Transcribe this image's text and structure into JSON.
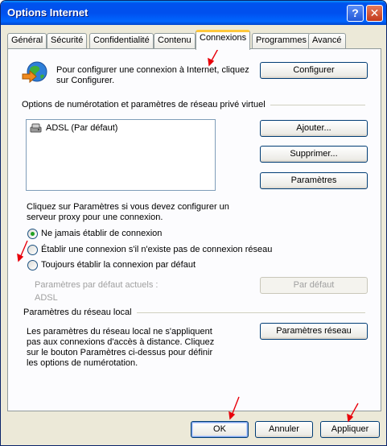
{
  "window": {
    "title": "Options Internet"
  },
  "tabs": [
    {
      "label": "Général"
    },
    {
      "label": "Sécurité"
    },
    {
      "label": "Confidentialité"
    },
    {
      "label": "Contenu"
    },
    {
      "label": "Connexions"
    },
    {
      "label": "Programmes"
    },
    {
      "label": "Avancé"
    }
  ],
  "setup": {
    "text_line1": "Pour configurer une connexion à Internet, cliquez",
    "text_line2": "sur Configurer.",
    "button": "Configurer"
  },
  "dialup": {
    "heading": "Options de numérotation et paramètres de réseau privé virtuel",
    "items": [
      "ADSL (Par défaut)"
    ],
    "add_button": "Ajouter...",
    "remove_button": "Supprimer...",
    "settings_button": "Paramètres",
    "proxy_text_line1": "Cliquez sur Paramètres si vous devez configurer un",
    "proxy_text_line2": "serveur proxy pour une connexion.",
    "options": [
      "Ne jamais établir de connexion",
      "Établir une connexion s'il n'existe pas de connexion réseau",
      "Toujours établir la connexion par défaut"
    ],
    "selected_option": "Ne jamais établir de connexion",
    "current_default_label": "Paramètres par défaut actuels :",
    "current_default_value": "ADSL",
    "default_button": "Par défaut"
  },
  "lan": {
    "heading": "Paramètres du réseau local",
    "text_lines": [
      "Les paramètres du réseau local ne s'appliquent",
      "pas aux connexions d'accès à distance. Cliquez",
      "sur le bouton Paramètres ci-dessus pour définir",
      "les options de numérotation."
    ],
    "button": "Paramètres réseau"
  },
  "footer": {
    "ok": "OK",
    "cancel": "Annuler",
    "apply": "Appliquer"
  },
  "colors": {
    "title_bar": "#0054e3",
    "dialog_bg": "#ece9d8",
    "annotation_arrow": "#e8000b"
  },
  "icons": [
    "help-icon",
    "close-icon",
    "internet-globe-icon",
    "dialup-connection-icon"
  ]
}
